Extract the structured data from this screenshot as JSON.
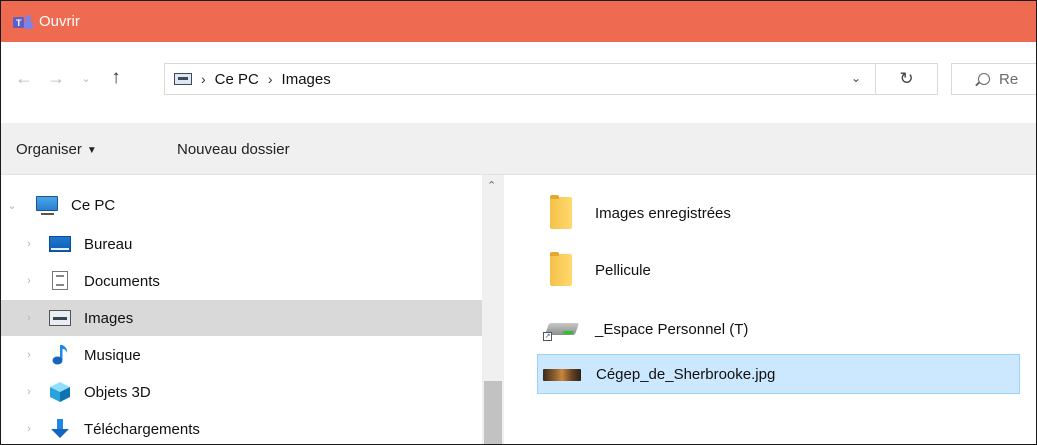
{
  "window": {
    "title": "Ouvrir",
    "titlebar_color": "#ee6a50",
    "app_icon": "teams-icon"
  },
  "nav": {
    "back_icon": "arrow-left-icon",
    "forward_icon": "arrow-right-icon",
    "recent_icon": "chevron-down-icon",
    "up_icon": "arrow-up-icon"
  },
  "address": {
    "root_icon": "images-library-icon",
    "crumbs": [
      "Ce PC",
      "Images"
    ],
    "dropdown_icon": "chevron-down-icon",
    "refresh_icon": "refresh-icon"
  },
  "search": {
    "placeholder_partial": "Re",
    "icon": "search-icon"
  },
  "toolbar": {
    "organise_label": "Organiser",
    "new_folder_label": "Nouveau dossier"
  },
  "navpane": {
    "items": [
      {
        "label": "Ce PC",
        "icon": "monitor-icon",
        "expanded": true
      },
      {
        "label": "Bureau",
        "icon": "desktop-icon"
      },
      {
        "label": "Documents",
        "icon": "document-icon"
      },
      {
        "label": "Images",
        "icon": "images-icon",
        "selected": true
      },
      {
        "label": "Musique",
        "icon": "music-note-icon"
      },
      {
        "label": "Objets 3D",
        "icon": "cube-3d-icon"
      },
      {
        "label": "Téléchargements",
        "icon": "download-arrow-icon"
      }
    ]
  },
  "files": {
    "items": [
      {
        "label": "Images enregistrées",
        "icon": "folder-icon"
      },
      {
        "label": "Pellicule",
        "icon": "folder-icon"
      },
      {
        "label": "_Espace Personnel (T)",
        "icon": "network-drive-icon"
      },
      {
        "label": "Cégep_de_Sherbrooke.jpg",
        "icon": "image-thumbnail-icon",
        "selected": true
      }
    ]
  },
  "colors": {
    "selection_blue": "#cce8ff",
    "selection_border": "#99d1ff",
    "nav_selected": "#d9d9d9",
    "toolbar_bg": "#f0f0f0"
  }
}
